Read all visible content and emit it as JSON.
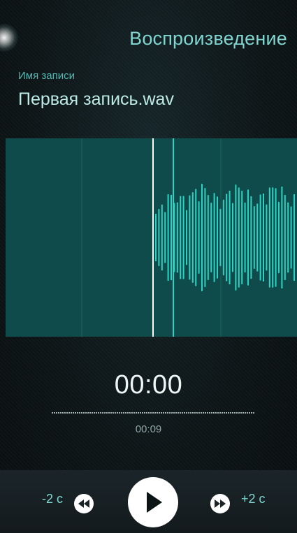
{
  "header": {
    "title": "Воспроизведение"
  },
  "recording": {
    "label": "Имя записи",
    "name": "Первая запись.wav"
  },
  "player": {
    "current_time": "00:00",
    "duration": "00:09",
    "progress": 0,
    "skip_back_label": "-2 с",
    "skip_forward_label": "+2 с",
    "icons": {
      "rewind": "rewind-icon",
      "play": "play-icon",
      "fast_forward": "fast-forward-icon"
    }
  },
  "colors": {
    "accent": "#7fd6d0",
    "waveform_bg": "#0f4b4a",
    "waveform_bars": "#2ad4c4",
    "playhead": "#ffffff"
  }
}
